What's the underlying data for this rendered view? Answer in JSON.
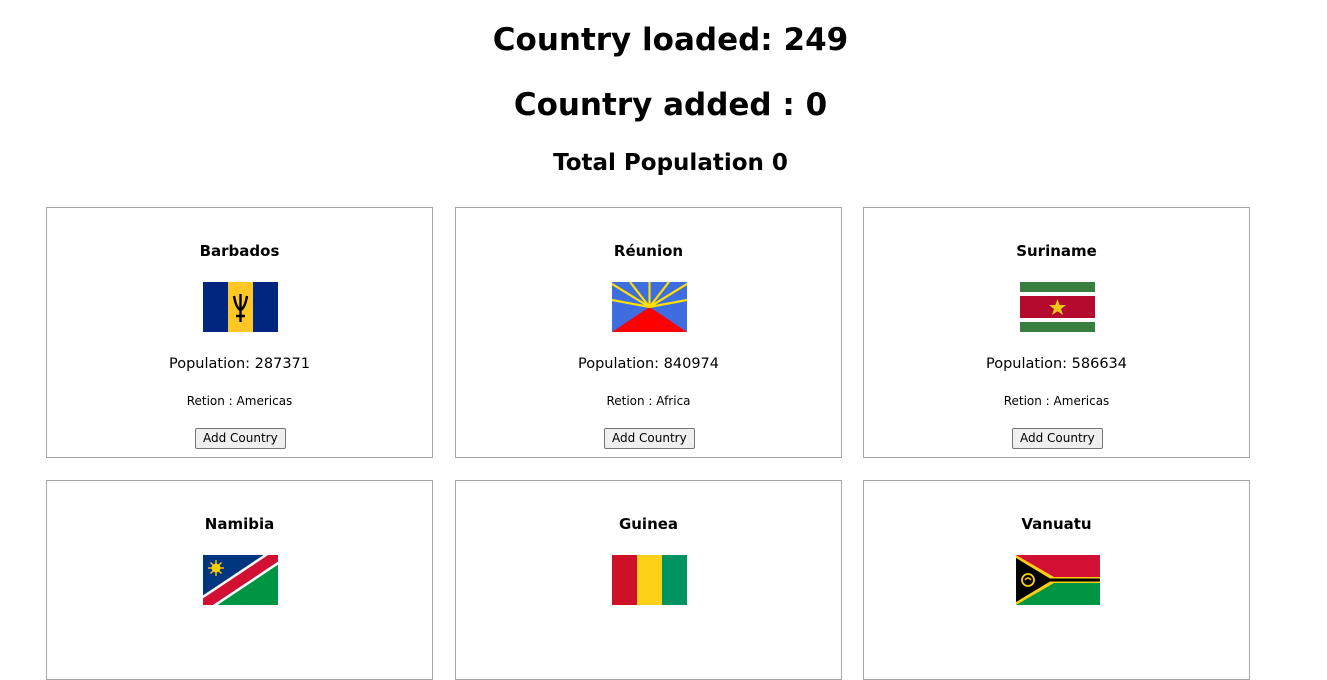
{
  "header": {
    "loaded_text": "Country loaded: 249",
    "added_text": "Country added : 0",
    "population_text": "Total Population 0"
  },
  "countries": [
    {
      "name": "Barbados",
      "population": "Population: 287371",
      "region": "Retion : Americas",
      "button": "Add Country",
      "flag": "barbados-flag-icon"
    },
    {
      "name": "Réunion",
      "population": "Population: 840974",
      "region": "Retion : Africa",
      "button": "Add Country",
      "flag": "reunion-flag-icon"
    },
    {
      "name": "Suriname",
      "population": "Population: 586634",
      "region": "Retion : Americas",
      "button": "Add Country",
      "flag": "suriname-flag-icon"
    },
    {
      "name": "Namibia",
      "flag": "namibia-flag-icon"
    },
    {
      "name": "Guinea",
      "flag": "guinea-flag-icon"
    },
    {
      "name": "Vanuatu",
      "flag": "vanuatu-flag-icon"
    }
  ]
}
